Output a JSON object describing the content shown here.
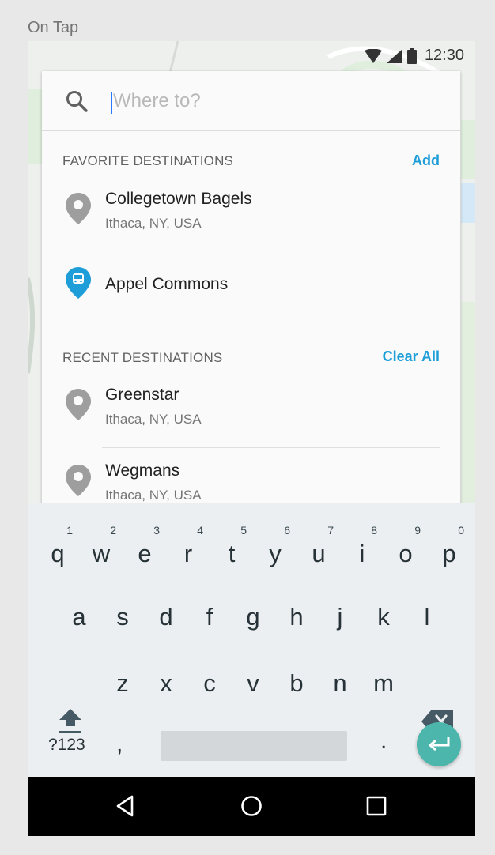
{
  "caption": "On Tap",
  "status": {
    "time": "12:30",
    "icons": [
      "wifi-icon",
      "cell-signal-icon",
      "battery-icon"
    ]
  },
  "search": {
    "placeholder": "Where to?",
    "value": ""
  },
  "favorites": {
    "header": "FAVORITE DESTINATIONS",
    "action": "Add",
    "items": [
      {
        "title": "Collegetown Bagels",
        "subtitle": "Ithaca, NY, USA",
        "icon": "location-pin-icon"
      },
      {
        "title": "Appel Commons",
        "subtitle": "",
        "icon": "bus-stop-pin-icon"
      }
    ]
  },
  "recent": {
    "header": "RECENT DESTINATIONS",
    "action": "Clear All",
    "items": [
      {
        "title": "Greenstar",
        "subtitle": "Ithaca, NY, USA",
        "icon": "location-pin-icon"
      },
      {
        "title": "Wegmans",
        "subtitle": "Ithaca, NY, USA",
        "icon": "location-pin-icon"
      }
    ]
  },
  "keyboard": {
    "row1": [
      {
        "ch": "q",
        "num": "1"
      },
      {
        "ch": "w",
        "num": "2"
      },
      {
        "ch": "e",
        "num": "3"
      },
      {
        "ch": "r",
        "num": "4"
      },
      {
        "ch": "t",
        "num": "5"
      },
      {
        "ch": "y",
        "num": "6"
      },
      {
        "ch": "u",
        "num": "7"
      },
      {
        "ch": "i",
        "num": "8"
      },
      {
        "ch": "o",
        "num": "9"
      },
      {
        "ch": "p",
        "num": "0"
      }
    ],
    "row2": [
      "a",
      "s",
      "d",
      "f",
      "g",
      "h",
      "j",
      "k",
      "l"
    ],
    "row3": [
      "z",
      "x",
      "c",
      "v",
      "b",
      "n",
      "m"
    ],
    "symbols": "?123",
    "comma": ",",
    "period": "."
  },
  "colors": {
    "accent": "#1e9ed8",
    "pin_gray": "#9e9e9e",
    "enter": "#4db6ac"
  }
}
